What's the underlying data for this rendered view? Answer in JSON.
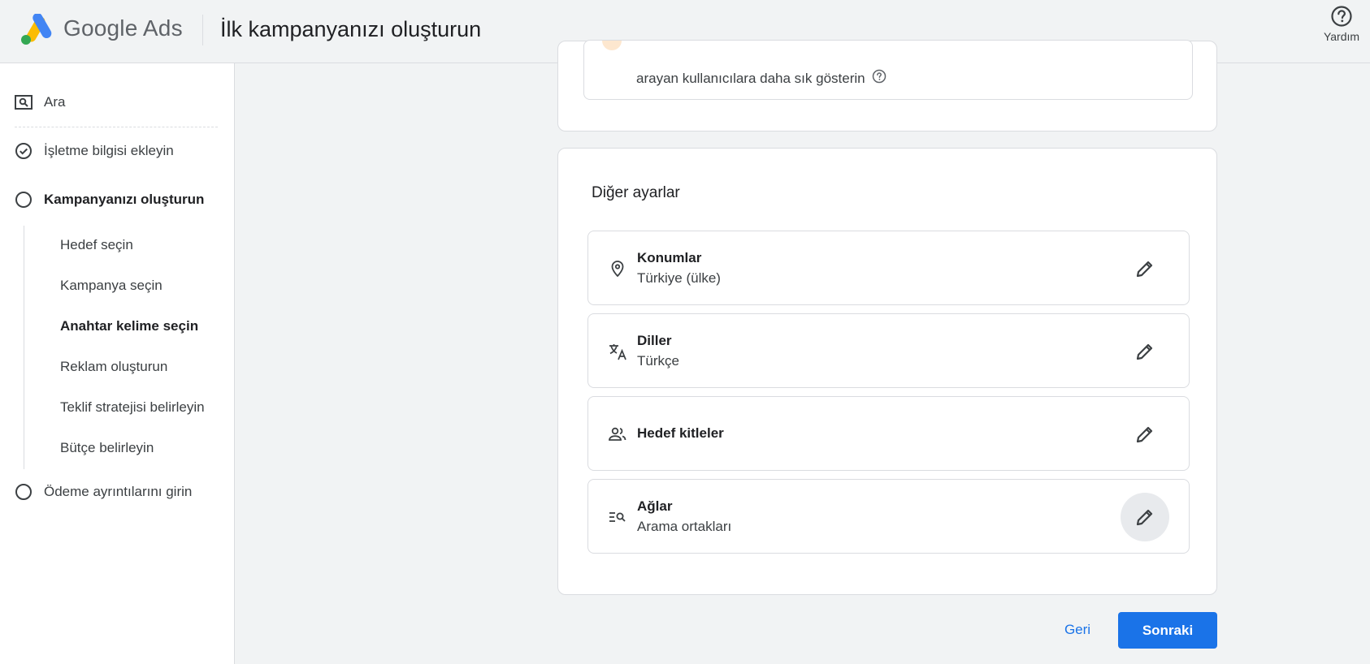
{
  "header": {
    "brand": "Google Ads",
    "title": "İlk kampanyanızı oluşturun",
    "help_label": "Yardım"
  },
  "sidebar": {
    "search_label": "Ara",
    "steps": [
      {
        "label": "İşletme bilgisi ekleyin",
        "state": "done"
      },
      {
        "label": "Kampanyanızı oluşturun",
        "state": "current"
      },
      {
        "label": "Ödeme ayrıntılarını girin",
        "state": "todo"
      }
    ],
    "substeps": [
      {
        "label": "Hedef seçin",
        "active": false
      },
      {
        "label": "Kampanya seçin",
        "active": false
      },
      {
        "label": "Anahtar kelime seçin",
        "active": true
      },
      {
        "label": "Reklam oluşturun",
        "active": false
      },
      {
        "label": "Teklif stratejisi belirleyin",
        "active": false
      },
      {
        "label": "Bütçe belirleyin",
        "active": false
      }
    ]
  },
  "top_card": {
    "text": "arayan kullanıcılara daha sık gösterin"
  },
  "other_settings": {
    "title": "Diğer ayarlar",
    "items": [
      {
        "icon": "location-pin-icon",
        "title": "Konumlar",
        "value": "Türkiye (ülke)"
      },
      {
        "icon": "translate-icon",
        "title": "Diller",
        "value": "Türkçe"
      },
      {
        "icon": "people-icon",
        "title": "Hedef kitleler",
        "value": ""
      },
      {
        "icon": "network-search-icon",
        "title": "Ağlar",
        "value": "Arama ortakları"
      }
    ]
  },
  "footer": {
    "back_label": "Geri",
    "next_label": "Sonraki"
  },
  "colors": {
    "accent": "#1a73e8",
    "background": "#f1f3f4",
    "border": "#dadce0"
  }
}
